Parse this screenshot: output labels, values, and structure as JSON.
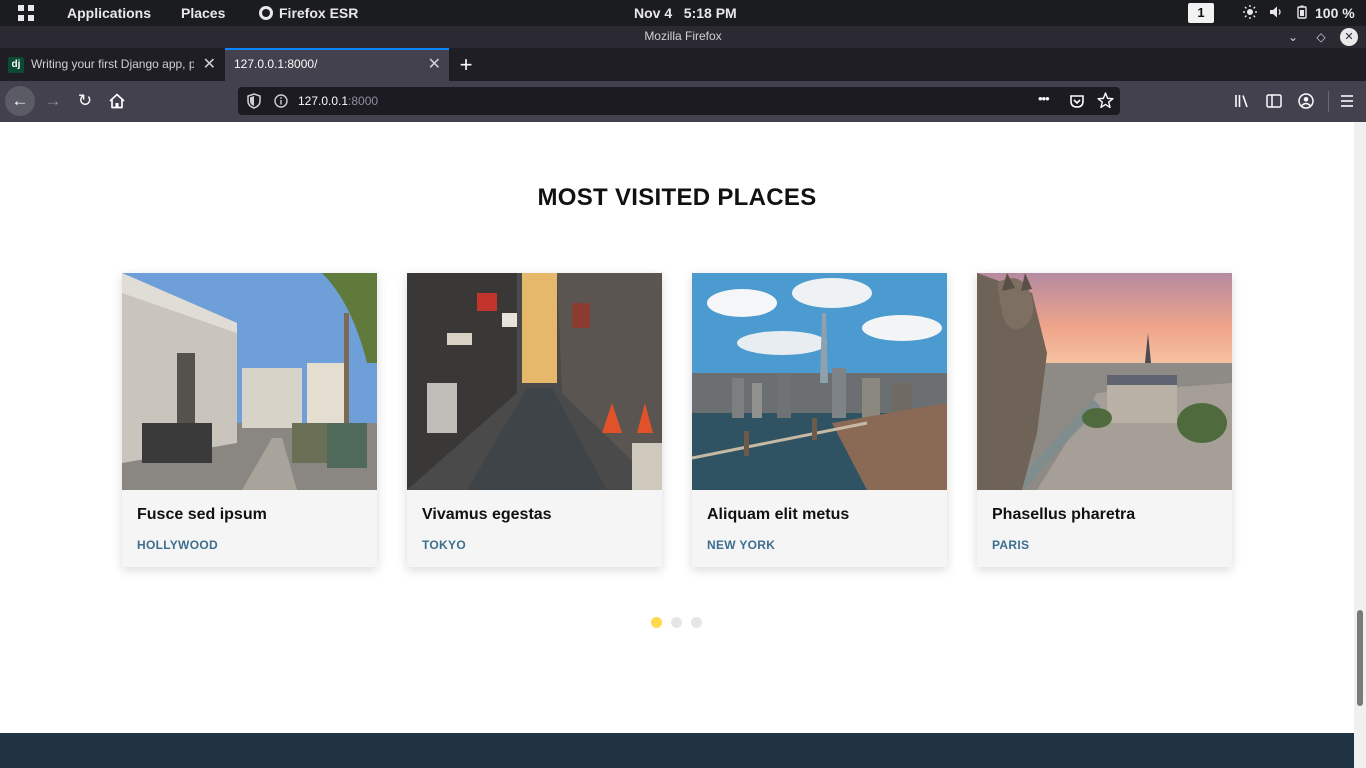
{
  "system_bar": {
    "applications": "Applications",
    "places": "Places",
    "active_app": "Firefox ESR",
    "clock": "Nov 4   5:18 PM",
    "workspace": "1",
    "battery": "100 %"
  },
  "window": {
    "title": "Mozilla Firefox"
  },
  "tabs": [
    {
      "favicon": "dj",
      "title": "Writing your first Django app, pa"
    },
    {
      "title": "127.0.0.1:8000/"
    }
  ],
  "navbar": {
    "url_host": "127.0.0.1",
    "url_port": ":8000",
    "page_actions": "•••"
  },
  "page": {
    "section_title": "MOST VISITED PLACES",
    "cards": [
      {
        "title": "Fusce sed ipsum",
        "place": "HOLLYWOOD"
      },
      {
        "title": "Vivamus egestas",
        "place": "TOKYO"
      },
      {
        "title": "Aliquam elit metus",
        "place": "NEW YORK"
      },
      {
        "title": "Phasellus pharetra",
        "place": "PARIS"
      }
    ],
    "carousel": {
      "pages": 3,
      "active_page": 1
    }
  },
  "colors": {
    "accent_tab": "#0a84ff",
    "place_label": "#3d6e8f",
    "dot_active": "#ffd84d",
    "footer": "#1f3343"
  }
}
